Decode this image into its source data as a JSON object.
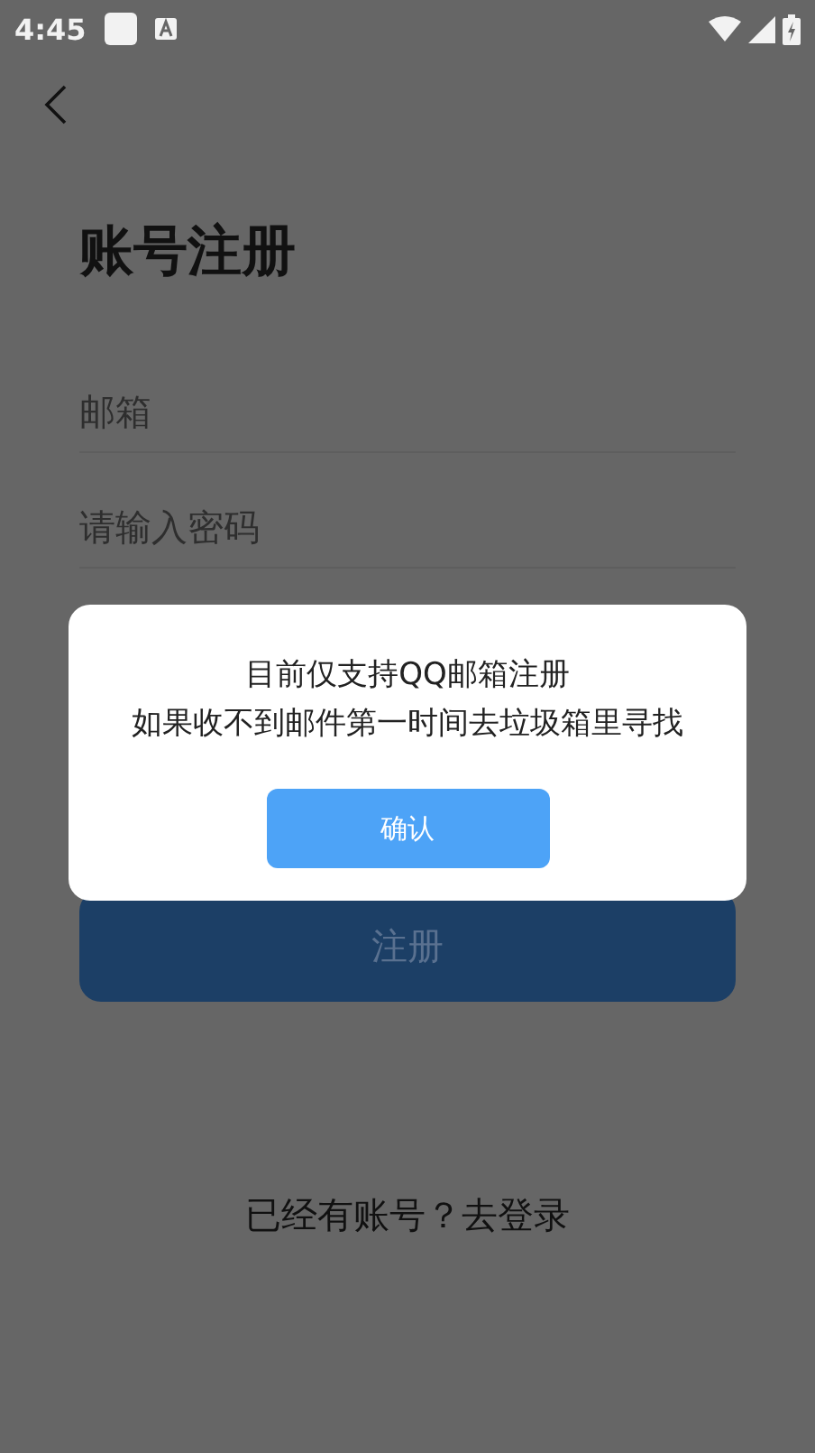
{
  "status_bar": {
    "time": "4:45"
  },
  "title": "账号注册",
  "fields": [
    {
      "placeholder": "邮箱"
    },
    {
      "placeholder": "请输入密码"
    }
  ],
  "register_button": "注册",
  "footer_link": "已经有账号？去登录",
  "dialog": {
    "lines": [
      "目前仅支持QQ邮箱注册",
      "如果收不到邮件第一时间去垃圾箱里寻找"
    ],
    "button": "确认"
  }
}
